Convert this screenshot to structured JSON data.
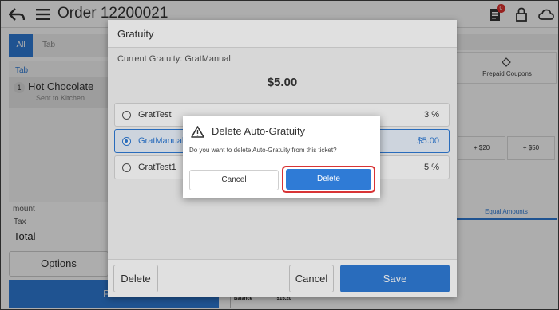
{
  "header": {
    "title": "Order 12200021",
    "notification_count": "0"
  },
  "left_panel": {
    "tabs": [
      {
        "label": "All"
      },
      {
        "label": "Tab"
      }
    ],
    "ticket_tab_label": "Tab",
    "items": [
      {
        "qty": "1",
        "name": "Hot Chocolate",
        "status": "Sent to Kitchen"
      }
    ],
    "totals": {
      "amount_label": "mount",
      "tax_label": "Tax",
      "total_label": "Total"
    },
    "options_label": "Options",
    "print_label": "Print"
  },
  "right_panel": {
    "coupon_label": "Prepaid Coupons",
    "amount_buttons": [
      "+ $20",
      "+ $50"
    ],
    "equal_amounts_label": "Equal Amounts",
    "receipt": {
      "balance_label": "Balance",
      "balance_value": "$15.20"
    }
  },
  "gratuity_dialog": {
    "title": "Gratuity",
    "current": "Current Gratuity: GratManual",
    "amount": "$5.00",
    "options": [
      {
        "name": "GratTest",
        "value": "3 %",
        "selected": false
      },
      {
        "name": "GratManual",
        "value": "$5.00",
        "selected": true
      },
      {
        "name": "GratTest1",
        "value": "5 %",
        "selected": false
      }
    ],
    "delete_label": "Delete",
    "cancel_label": "Cancel",
    "save_label": "Save"
  },
  "confirm_dialog": {
    "title": "Delete Auto-Gratuity",
    "message": "Do you want to delete Auto-Gratuity from this ticket?",
    "cancel_label": "Cancel",
    "delete_label": "Delete"
  },
  "colors": {
    "accent": "#2f7bd6",
    "highlight_ring": "#d83436",
    "badge": "#e0322f"
  },
  "icons": [
    "back-icon",
    "menu-icon",
    "receipt-icon",
    "lock-icon",
    "cloud-icon",
    "tag-icon",
    "warning-icon"
  ]
}
